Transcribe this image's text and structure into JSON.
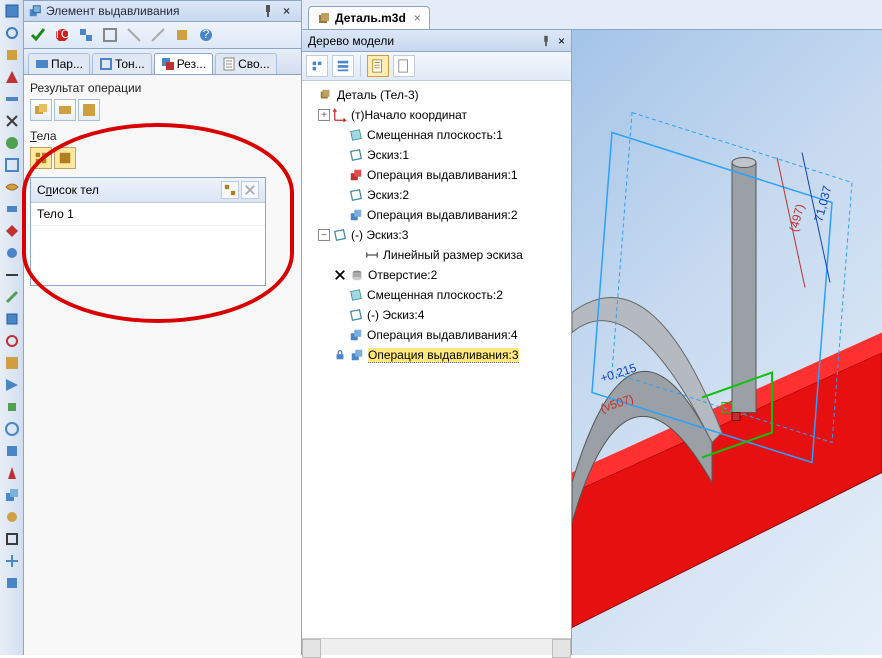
{
  "props_panel": {
    "title": "Элемент выдавливания",
    "tabs": [
      {
        "label": "Пар..."
      },
      {
        "label": "Тон..."
      },
      {
        "label": "Рез..."
      },
      {
        "label": "Сво..."
      }
    ],
    "result_label": "Результат операции",
    "tela_label": "Тела",
    "list_header": "Список тел",
    "list_items": [
      "Тело 1"
    ]
  },
  "doc_tab": {
    "title": "Деталь.m3d"
  },
  "tree_panel": {
    "title": "Дерево модели",
    "root": "Деталь (Тел-3)",
    "nodes": [
      {
        "label": "(т)Начало координат",
        "icon": "axis",
        "indent": 1,
        "exp": "+"
      },
      {
        "label": "Смещенная плоскость:1",
        "icon": "plane",
        "indent": 1
      },
      {
        "label": "Эскиз:1",
        "icon": "sketch",
        "indent": 1
      },
      {
        "label": "Операция выдавливания:1",
        "icon": "extrude-red",
        "indent": 1
      },
      {
        "label": "Эскиз:2",
        "icon": "sketch",
        "indent": 1
      },
      {
        "label": "Операция выдавливания:2",
        "icon": "extrude-blue",
        "indent": 1
      },
      {
        "label": "(-) Эскиз:3",
        "icon": "sketch",
        "indent": 1,
        "exp": "-"
      },
      {
        "label": "Линейный размер эскиза",
        "icon": "dim",
        "indent": 2
      },
      {
        "label": "Отверстие:2",
        "icon": "hole",
        "indent": 1,
        "excluded": true
      },
      {
        "label": "Смещенная плоскость:2",
        "icon": "plane",
        "indent": 1
      },
      {
        "label": "(-) Эскиз:4",
        "icon": "sketch",
        "indent": 1
      },
      {
        "label": "Операция выдавливания:4",
        "icon": "extrude-blue",
        "indent": 1
      },
      {
        "label": "Операция выдавливания:3",
        "icon": "extrude-blue",
        "indent": 1,
        "locked": true,
        "selected": true
      }
    ]
  },
  "annotations": {
    "dim1": "+0,215",
    "dim2": "(v507)",
    "dim3": "71,037",
    "dim4": "(497)"
  }
}
